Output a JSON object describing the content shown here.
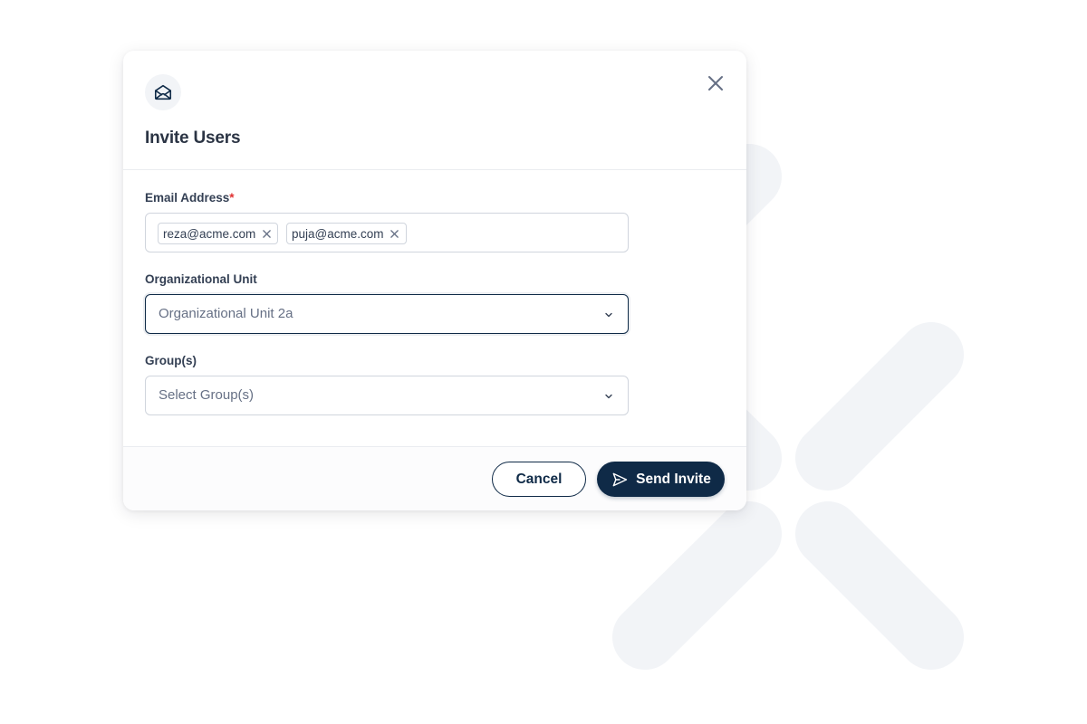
{
  "dialog": {
    "title": "Invite Users",
    "header_icon": "envelope-open-icon",
    "close_icon": "close-icon"
  },
  "email_field": {
    "label": "Email Address",
    "required_mark": "*",
    "chips": [
      {
        "value": "reza@acme.com"
      },
      {
        "value": "puja@acme.com"
      }
    ]
  },
  "org_unit_field": {
    "label": "Organizational Unit",
    "value": "Organizational Unit 2a",
    "state": "focused"
  },
  "groups_field": {
    "label": "Group(s)",
    "placeholder": "Select Group(s)"
  },
  "footer": {
    "cancel_label": "Cancel",
    "send_label": "Send Invite",
    "send_icon": "send-icon"
  },
  "colors": {
    "primary": "#0f2a47",
    "required": "#e03131",
    "background_mark": "#f2f4f7"
  }
}
